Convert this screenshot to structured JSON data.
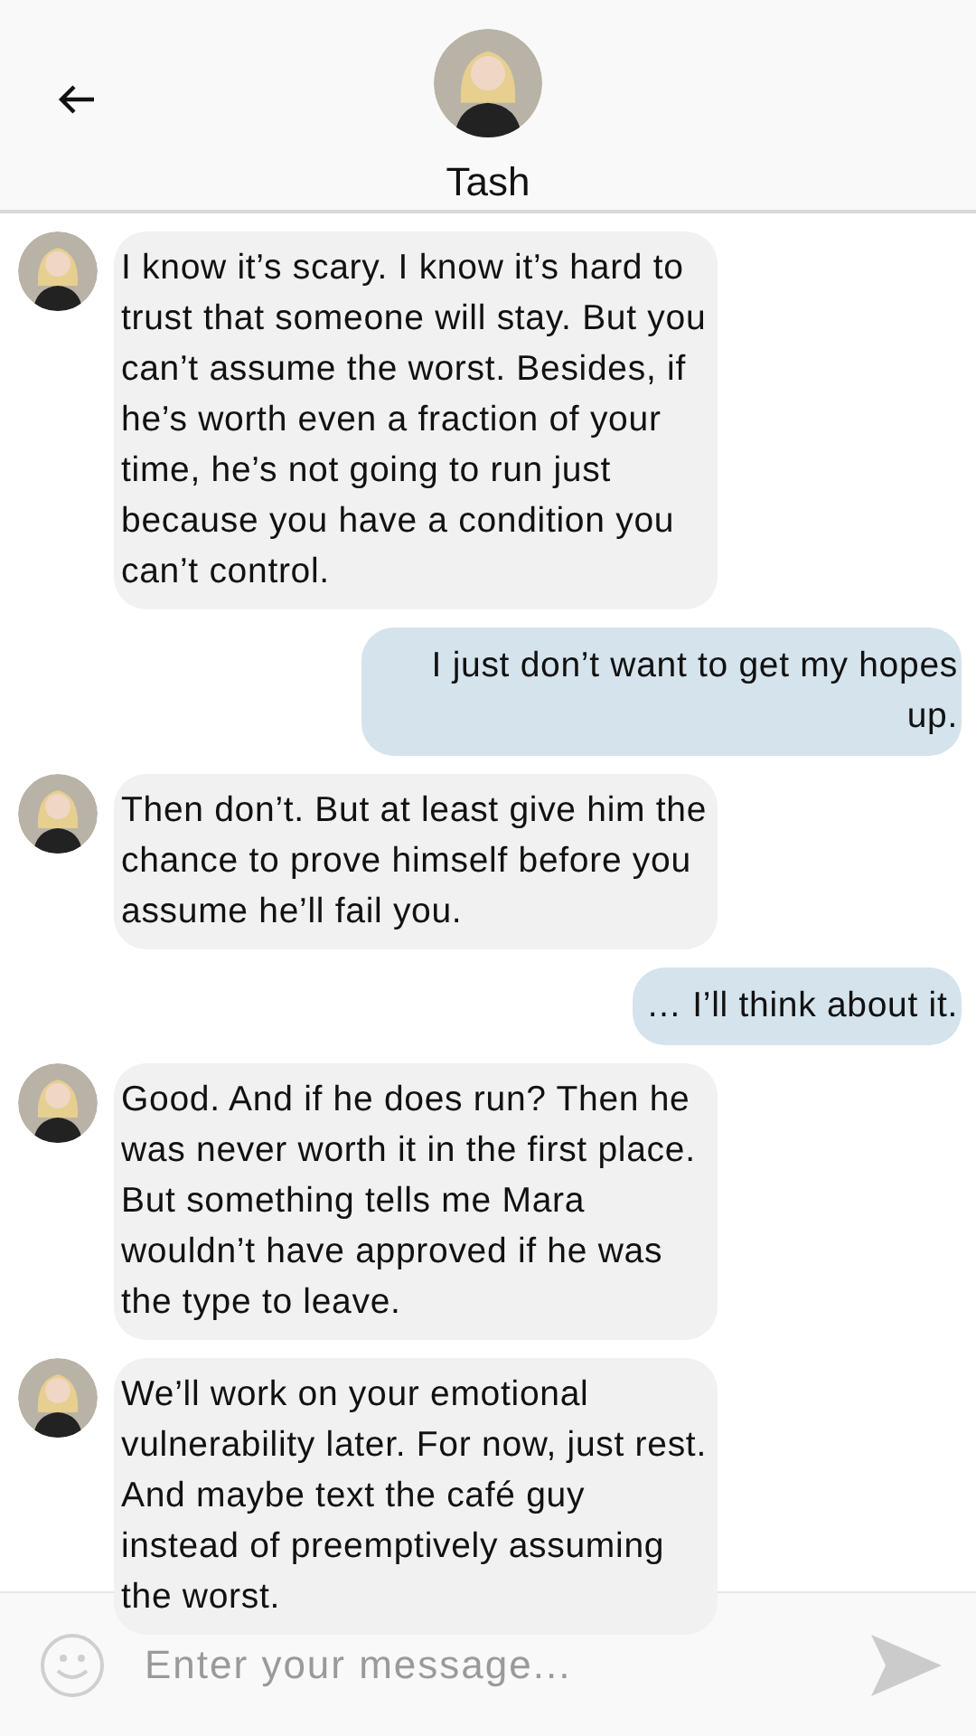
{
  "header": {
    "contact_name": "Tash"
  },
  "messages": [
    {
      "kind": "incoming",
      "text": "I know it’s scary. I know it’s hard to trust that someone will stay. But you can’t assume the worst. Besides, if he’s worth even a fraction of your time, he’s not going to run just because you have a condition you can’t control."
    },
    {
      "kind": "outgoing",
      "text": "I just don’t want to get my hopes up."
    },
    {
      "kind": "incoming",
      "text": "Then don’t. But at least give him the chance to prove himself before you assume he’ll fail you."
    },
    {
      "kind": "outgoing",
      "text": "… I’ll think about it."
    },
    {
      "kind": "incoming",
      "text": "Good. And if he does run? Then he was never worth it in the first place. But something tells me Mara wouldn’t have approved if he was the type to leave."
    },
    {
      "kind": "incoming",
      "text": "We’ll work on your emotional vulnerability later. For now, just rest. And maybe text the café guy instead of preemptively assuming the worst."
    }
  ],
  "composer": {
    "placeholder": "Enter your message..."
  }
}
